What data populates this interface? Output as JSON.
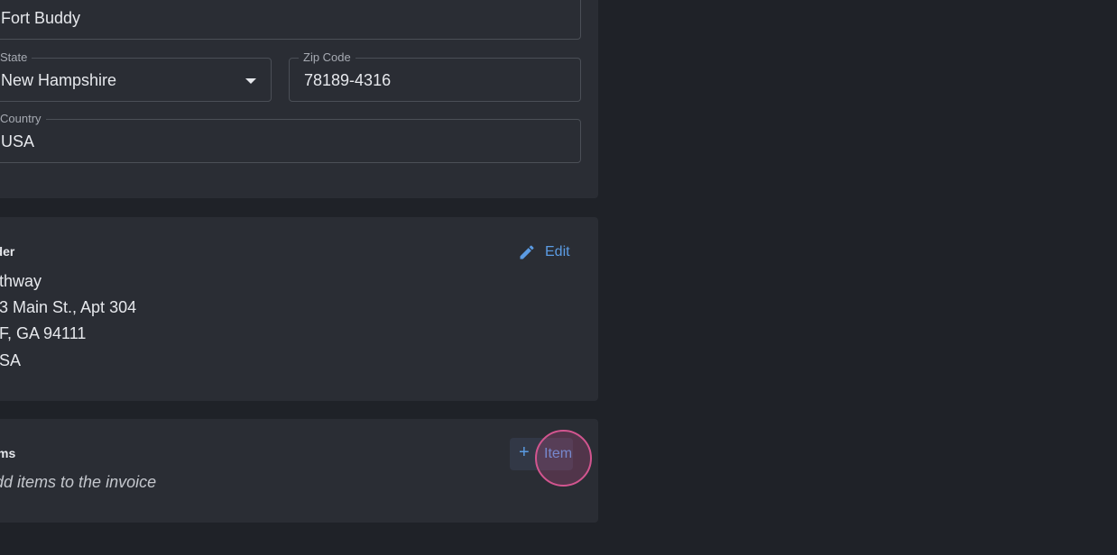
{
  "address_form": {
    "city_value": "Fort Buddy",
    "state_label": "State",
    "state_value": "New Hampshire",
    "zip_label": "Zip Code",
    "zip_value": "78189-4316",
    "country_label": "Country",
    "country_value": "USA"
  },
  "sender": {
    "heading": "nder",
    "edit_label": "Edit",
    "lines": [
      "thway",
      "3 Main St., Apt 304",
      "F, GA 94111",
      "SA"
    ]
  },
  "items": {
    "heading": "ms",
    "empty_message": "dd items to the invoice",
    "add_item_label": "Item"
  },
  "colors": {
    "background": "#1f2228",
    "card": "#2a2d34",
    "accent": "#5b9be3",
    "click_indicator": "#d2558f"
  },
  "icons": {
    "edit": "pencil-icon",
    "add": "plus-icon",
    "state_dropdown": "caret-down-icon"
  }
}
